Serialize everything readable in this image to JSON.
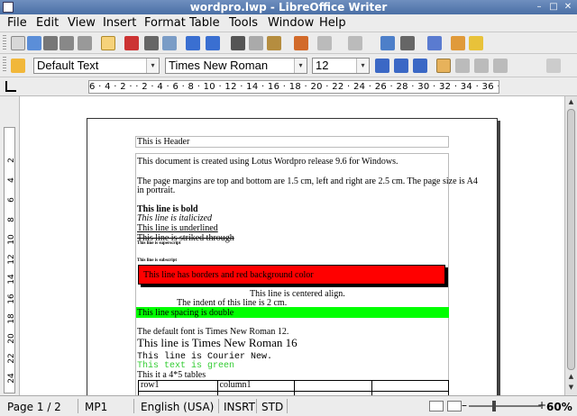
{
  "window": {
    "title": "wordpro.lwp - LibreOffice Writer",
    "minimize_glyph": "–",
    "maximize_glyph": "□",
    "close_glyph": "✕"
  },
  "menu": [
    "File",
    "Edit",
    "View",
    "Insert",
    "Format",
    "Table",
    "Tools",
    "Window",
    "Help"
  ],
  "formatting": {
    "paragraph_style": "Default Text",
    "font_name": "Times New Roman",
    "font_size": "12",
    "dropdown_arrow": "▾"
  },
  "ruler": {
    "labels": "6 · 4 · 2 ·   · 2 · 4 · 6 · 8 · 10 · 12 · 14 · 16 · 18 · 20 · 22 · 24 · 26 · 28 · 30 · 32 · 34 · 36 · 38 · 40 · 42 44 · 46 · 48 ·",
    "vertical_labels": [
      "2",
      "4",
      "6",
      "8",
      "10",
      "12",
      "14",
      "16",
      "18",
      "20",
      "22",
      "24"
    ]
  },
  "document": {
    "header": "This is Header",
    "intro": "This document is created using Lotus Wordpro release 9.6 for Windows.",
    "margins_1": "The page margins are top and bottom are 1.5 cm, left and right are 2.5 cm. The page size is A4",
    "margins_2": "in portrait.",
    "bold": "This line is bold",
    "italic": "This line is italicized",
    "underline": "This line is underlined",
    "strike": "This line is striked through",
    "superscript": "This line is superscript",
    "subscript": "This line is subscript",
    "bordered": "This line has borders and red background color",
    "centered": "This line is centered align.",
    "indent": "The indent of this line is 2 cm.",
    "double_spacing": "This line spacing is double",
    "default_font": "The default font is Times New Roman 12.",
    "tnr16": "This line is Times New Roman 16",
    "courier": "This line is Courier New.",
    "green_text": "This text is green",
    "table_intro": "This it a 4*5 tables",
    "table_rows": [
      [
        "row1",
        "column1",
        "",
        "",
        ""
      ],
      [
        "",
        "",
        "",
        "",
        ""
      ]
    ]
  },
  "status": {
    "page": "Page 1 / 2",
    "style": "MP1",
    "language": "English (USA)",
    "insert_mode": "INSRT",
    "selection_mode": "STD",
    "zoom": "60%",
    "zoom_minus": "–",
    "zoom_plus": "+"
  },
  "colors": {
    "highlight_red": "#ff0000",
    "highlight_green": "#00ff00",
    "green_text": "#33cc33"
  }
}
